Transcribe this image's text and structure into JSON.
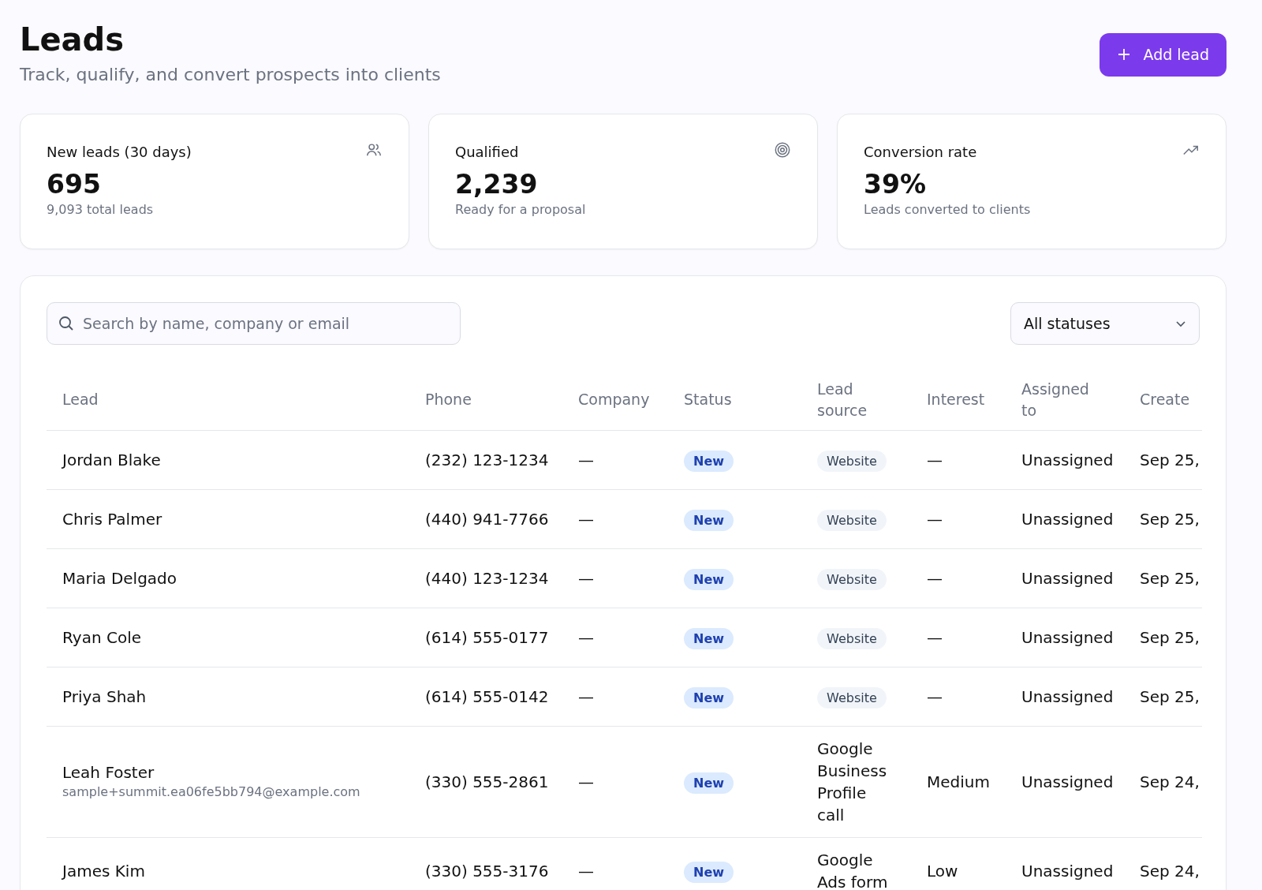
{
  "header": {
    "title": "Leads",
    "subtitle": "Track, qualify, and convert prospects into clients",
    "add_button": "Add lead"
  },
  "stats": [
    {
      "label": "New leads (30 days)",
      "value": "695",
      "note": "9,093 total leads"
    },
    {
      "label": "Qualified",
      "value": "2,239",
      "note": "Ready for a proposal"
    },
    {
      "label": "Conversion rate",
      "value": "39%",
      "note": "Leads converted to clients"
    }
  ],
  "filters": {
    "search_placeholder": "Search by name, company or email",
    "status_select": "All statuses"
  },
  "table": {
    "columns": [
      "Lead",
      "Phone",
      "Company",
      "Status",
      "Lead source",
      "Interest",
      "Assigned to",
      "Create"
    ],
    "rows": [
      {
        "name": "Jordan Blake",
        "phone": "(232) 123-1234",
        "company": "—",
        "status": "New",
        "source": "Website",
        "kind": "chip",
        "interest": "—",
        "assigned": "Unassigned",
        "created": "Sep 25,"
      },
      {
        "name": "Chris Palmer",
        "phone": "(440) 941-7766",
        "company": "—",
        "status": "New",
        "source": "Website",
        "kind": "chip",
        "interest": "—",
        "assigned": "Unassigned",
        "created": "Sep 25,"
      },
      {
        "name": "Maria Delgado",
        "phone": "(440) 123-1234",
        "company": "—",
        "status": "New",
        "source": "Website",
        "kind": "chip",
        "interest": "—",
        "assigned": "Unassigned",
        "created": "Sep 25,"
      },
      {
        "name": "Ryan Cole",
        "phone": "(614) 555-0177",
        "company": "—",
        "status": "New",
        "source": "Website",
        "kind": "chip",
        "interest": "—",
        "assigned": "Unassigned",
        "created": "Sep 25,"
      },
      {
        "name": "Priya Shah",
        "phone": "(614) 555-0142",
        "company": "—",
        "status": "New",
        "source": "Website",
        "kind": "chip",
        "interest": "—",
        "assigned": "Unassigned",
        "created": "Sep 25,"
      },
      {
        "name": "Leah Foster",
        "email": "sample+summit.ea06fe5bb794@example.com",
        "phone": "(330) 555-2861",
        "company": "—",
        "status": "New",
        "source": "Google Business Profile call",
        "kind": "text",
        "interest": "Medium",
        "assigned": "Unassigned",
        "created": "Sep 24,"
      },
      {
        "name": "James Kim",
        "phone": "(330) 555-3176",
        "company": "—",
        "status": "New",
        "source": "Google Ads form",
        "kind": "text",
        "interest": "Low",
        "assigned": "Unassigned",
        "created": "Sep 24,"
      }
    ]
  }
}
